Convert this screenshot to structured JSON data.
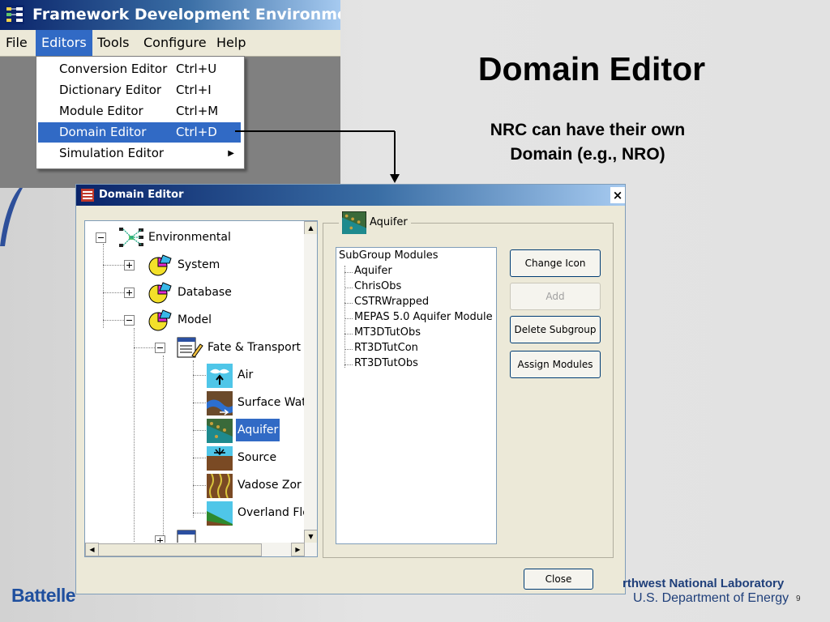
{
  "slide": {
    "title": "Domain Editor",
    "subtitle_line1": "NRC can have their own",
    "subtitle_line2": "Domain (e.g., NRO)",
    "footer_logo": "Battelle",
    "footer_lab": "rthwest National Laboratory",
    "footer_doe": "U.S. Department of Energy",
    "page_number": "9"
  },
  "framework_window": {
    "title": "Framework Development Environment",
    "menu": [
      "File",
      "Editors",
      "Tools",
      "Configure",
      "Help"
    ],
    "active_menu": "Editors",
    "dropdown": [
      {
        "label": "Conversion Editor",
        "shortcut": "Ctrl+U"
      },
      {
        "label": "Dictionary Editor",
        "shortcut": "Ctrl+I"
      },
      {
        "label": "Module Editor",
        "shortcut": "Ctrl+M"
      },
      {
        "label": "Domain Editor",
        "shortcut": "Ctrl+D",
        "selected": true
      },
      {
        "label": "Simulation Editor",
        "shortcut": "",
        "submenu": true
      }
    ]
  },
  "domain_editor": {
    "title": "Domain Editor",
    "close_glyph": "×",
    "tree": {
      "root": "Environmental",
      "system": "System",
      "database": "Database",
      "model": "Model",
      "fate": "Fate & Transport",
      "air": "Air",
      "surface": "Surface Wat",
      "aquifer": "Aquifer",
      "source": "Source",
      "vadose": "Vadose Zor",
      "overland": "Overland Flo"
    },
    "group_label": "Aquifer",
    "list_header": "SubGroup Modules",
    "modules": [
      "Aquifer",
      "ChrisObs",
      "CSTRWrapped",
      "MEPAS 5.0 Aquifer Module",
      "MT3DTutObs",
      "RT3DTutCon",
      "RT3DTutObs"
    ],
    "buttons": {
      "change_icon": "Change Icon",
      "add": "Add",
      "delete_subgroup": "Delete Subgroup",
      "assign_modules": "Assign Modules",
      "close": "Close"
    }
  }
}
